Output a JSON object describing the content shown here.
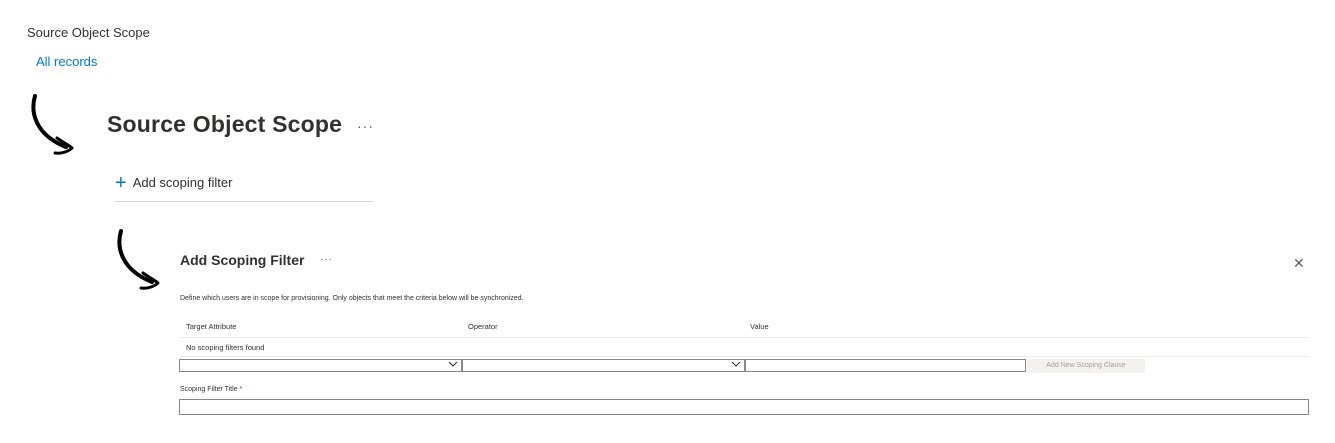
{
  "breadcrumb": {
    "title": "Source Object Scope",
    "link": "All records"
  },
  "page": {
    "title": "Source Object Scope",
    "more": "···"
  },
  "actions": {
    "add_filter_icon": "+",
    "add_filter_label": "Add scoping filter"
  },
  "panel": {
    "title": "Add Scoping Filter",
    "more": "···",
    "close": "✕",
    "description": "Define which users are in scope for provisioning. Only objects that meet the criteria below will be synchronized.",
    "columns": {
      "attribute": "Target Attribute",
      "operator": "Operator",
      "value": "Value"
    },
    "empty_message": "No scoping filters found",
    "attribute_select": {
      "value": ""
    },
    "operator_select": {
      "value": ""
    },
    "value_input": {
      "value": ""
    },
    "add_clause_button": "Add New Scoping Clause",
    "filter_title_label": "Scoping Filter Title",
    "required_mark": "*",
    "filter_title_value": ""
  },
  "colors": {
    "link": "#0078d4",
    "text": "#323130",
    "required": "#a4262c"
  },
  "icons": {
    "chevron": "chevron-down-icon",
    "arrow": "curved-arrow-icon",
    "close": "close-icon",
    "add": "plus-icon"
  }
}
